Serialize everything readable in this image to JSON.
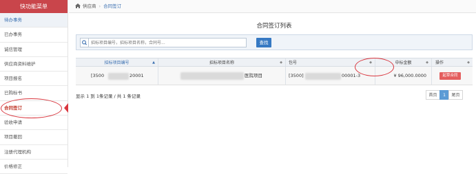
{
  "sidebar": {
    "header": "快功能菜单",
    "items": [
      {
        "label": "待办事务"
      },
      {
        "label": "已办事务"
      },
      {
        "label": "诚信管理"
      },
      {
        "label": "供应商资料维护"
      },
      {
        "label": "项目报名"
      },
      {
        "label": "已购标书"
      },
      {
        "label": "合同签订"
      },
      {
        "label": "验收申请"
      },
      {
        "label": "项目撤回"
      },
      {
        "label": "注册代理机构"
      },
      {
        "label": "价格修正"
      }
    ]
  },
  "breadcrumb": {
    "home": "供应商",
    "current": "合同签订"
  },
  "panel": {
    "title": "合同签订列表"
  },
  "search": {
    "placeholder": "招标项目编号，招标项目名称，合同号...",
    "button": "查找"
  },
  "table": {
    "headers": [
      "招标项目编号",
      "招标项目名称",
      "包号",
      "中标金额",
      "操作"
    ],
    "row": {
      "project_no_prefix": "[3500",
      "project_no_suffix": "20001",
      "project_name_suffix": "医院项目",
      "package_prefix": "[3500]",
      "package_suffix": "00001-3",
      "amount": "¥ 96,000.0000",
      "action": "起草合同"
    }
  },
  "footer": {
    "summary": "显示 1 到 1条记录 / 共 1 条记录"
  },
  "pagination": {
    "first": "首页",
    "page": "1",
    "last": "尾页"
  },
  "colors": {
    "header_red": "#c9454b",
    "accent_blue": "#3679c3",
    "annotation_red": "#d9363e",
    "action_red": "#e45e5e"
  }
}
